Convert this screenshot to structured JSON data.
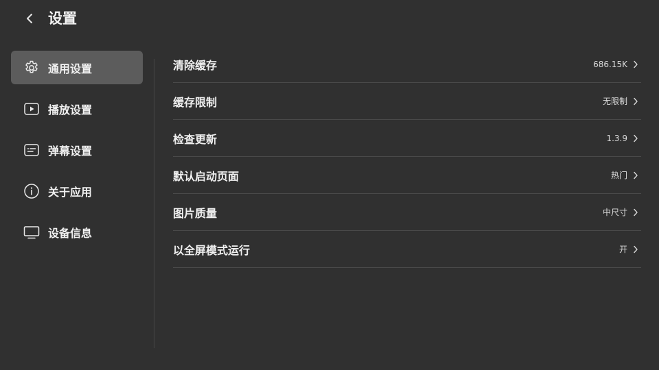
{
  "header": {
    "title": "设置",
    "back_icon": "chevron-left-icon"
  },
  "sidebar": {
    "items": [
      {
        "label": "通用设置",
        "icon": "gear-icon",
        "active": true
      },
      {
        "label": "播放设置",
        "icon": "play-icon",
        "active": false
      },
      {
        "label": "弹幕设置",
        "icon": "danmaku-icon",
        "active": false
      },
      {
        "label": "关于应用",
        "icon": "info-icon",
        "active": false
      },
      {
        "label": "设备信息",
        "icon": "monitor-icon",
        "active": false
      }
    ]
  },
  "settings": {
    "rows": [
      {
        "label": "清除缓存",
        "value": "686.15K"
      },
      {
        "label": "缓存限制",
        "value": "无限制"
      },
      {
        "label": "检查更新",
        "value": "1.3.9"
      },
      {
        "label": "默认启动页面",
        "value": "热门"
      },
      {
        "label": "图片质量",
        "value": "中尺寸"
      },
      {
        "label": "以全屏模式运行",
        "value": "开"
      }
    ]
  },
  "colors": {
    "background": "#303030",
    "active_item": "#5c5c5c",
    "divider": "#4a4a4a",
    "text": "#f0f0f0"
  }
}
